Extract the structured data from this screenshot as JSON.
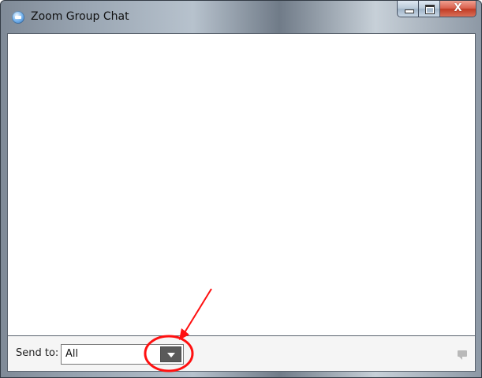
{
  "window": {
    "title": "Zoom Group Chat",
    "controls": {
      "minimize": "",
      "maximize": "",
      "close": "X"
    }
  },
  "chat": {
    "send_to_label": "Send to:",
    "recipient": "All",
    "message_value": "",
    "message_placeholder": ""
  },
  "annotation": {
    "color": "#ff1010"
  }
}
